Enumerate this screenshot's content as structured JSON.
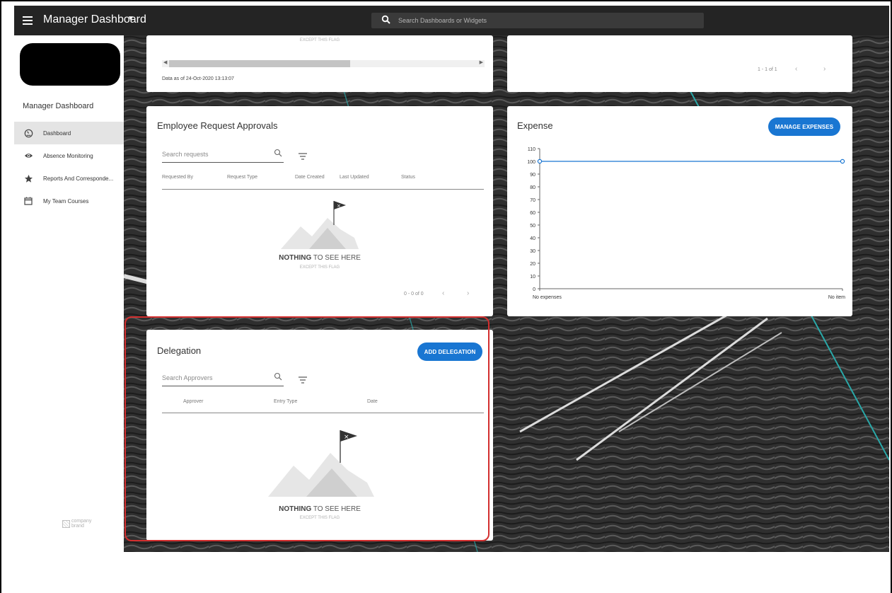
{
  "topbar": {
    "title": "Manager Dashboard",
    "search_placeholder": "Search Dashboards or Widgets"
  },
  "sidebar": {
    "title": "Manager Dashboard",
    "items": [
      {
        "label": "Dashboard",
        "icon": "dashboard-gauge-icon",
        "active": true
      },
      {
        "label": "Absence Monitoring",
        "icon": "eye-icon",
        "active": false
      },
      {
        "label": "Reports And Corresponde...",
        "icon": "star-icon",
        "active": false
      },
      {
        "label": "My Team Courses",
        "icon": "calendar-icon",
        "active": false
      }
    ],
    "brand": {
      "line1": "company",
      "line2": "brand"
    }
  },
  "top_left_card": {
    "empty_sub": "EXCEPT THIS FLAG",
    "data_as_of": "Data as of 24-Oct-2020 13:13:07"
  },
  "top_right_card": {
    "pager": "1 - 1 of 1"
  },
  "approvals": {
    "title": "Employee Request Approvals",
    "search_placeholder": "Search requests",
    "columns": [
      "Requested By",
      "Request Type",
      "Date Created",
      "Last Updated",
      "Status"
    ],
    "empty_bold": "NOTHING",
    "empty_rest": " TO SEE HERE",
    "empty_sub": "EXCEPT THIS FLAG",
    "pager": "0 - 0 of 0"
  },
  "expense": {
    "title": "Expense",
    "button": "MANAGE EXPENSES"
  },
  "delegation": {
    "title": "Delegation",
    "button": "ADD DELEGATION",
    "search_placeholder": "Search Approvers",
    "columns": [
      "Approver",
      "Entry Type",
      "Date"
    ],
    "empty_bold": "NOTHING",
    "empty_rest": " TO SEE HERE",
    "empty_sub": "EXCEPT THIS FLAG"
  },
  "chart_data": {
    "type": "line",
    "categories": [
      "No expenses",
      "No item"
    ],
    "series": [
      {
        "values": [
          100,
          100
        ]
      }
    ],
    "ylim": [
      0,
      110
    ],
    "yticks": [
      0,
      10,
      20,
      30,
      40,
      50,
      60,
      70,
      80,
      90,
      100,
      110
    ],
    "color": "#1976d2"
  },
  "colors": {
    "accent": "#1976d2",
    "topbar": "#242424",
    "highlight": "#d32f2f"
  }
}
